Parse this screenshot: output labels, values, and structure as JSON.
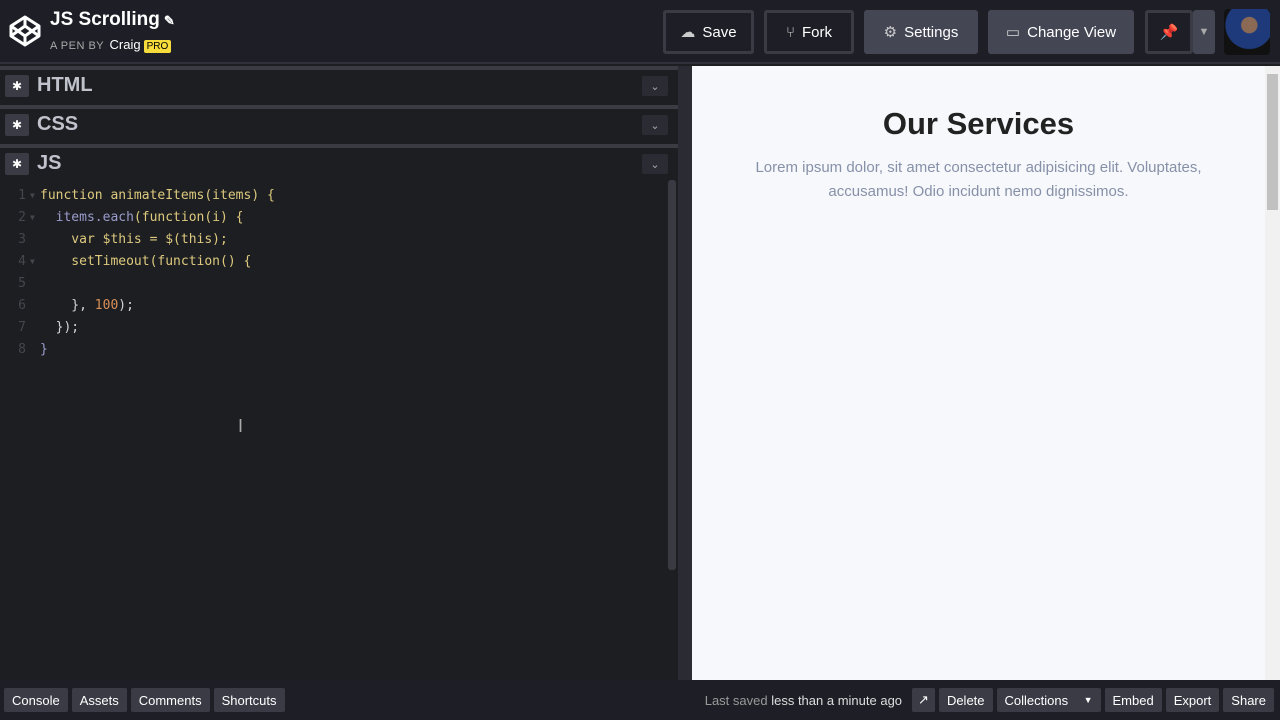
{
  "header": {
    "title": "JS Scrolling",
    "by_label": "A PEN BY",
    "user": "Craig",
    "badge": "PRO",
    "buttons": {
      "save": "Save",
      "fork": "Fork",
      "settings": "Settings",
      "change_view": "Change View"
    }
  },
  "editor": {
    "sections": [
      "HTML",
      "CSS",
      "JS"
    ],
    "lines": [
      "1",
      "2",
      "3",
      "4",
      "5",
      "6",
      "7",
      "8"
    ]
  },
  "preview": {
    "heading": "Our Services",
    "text": "Lorem ipsum dolor, sit amet consectetur adipisicing elit. Voluptates, accusamus! Odio incidunt nemo dignissimos."
  },
  "footer": {
    "left": [
      "Console",
      "Assets",
      "Comments",
      "Shortcuts"
    ],
    "saved_prefix": "Last saved",
    "saved_time": "less than a minute ago",
    "right": {
      "delete": "Delete",
      "collections": "Collections",
      "embed": "Embed",
      "export": "Export",
      "share": "Share"
    }
  }
}
